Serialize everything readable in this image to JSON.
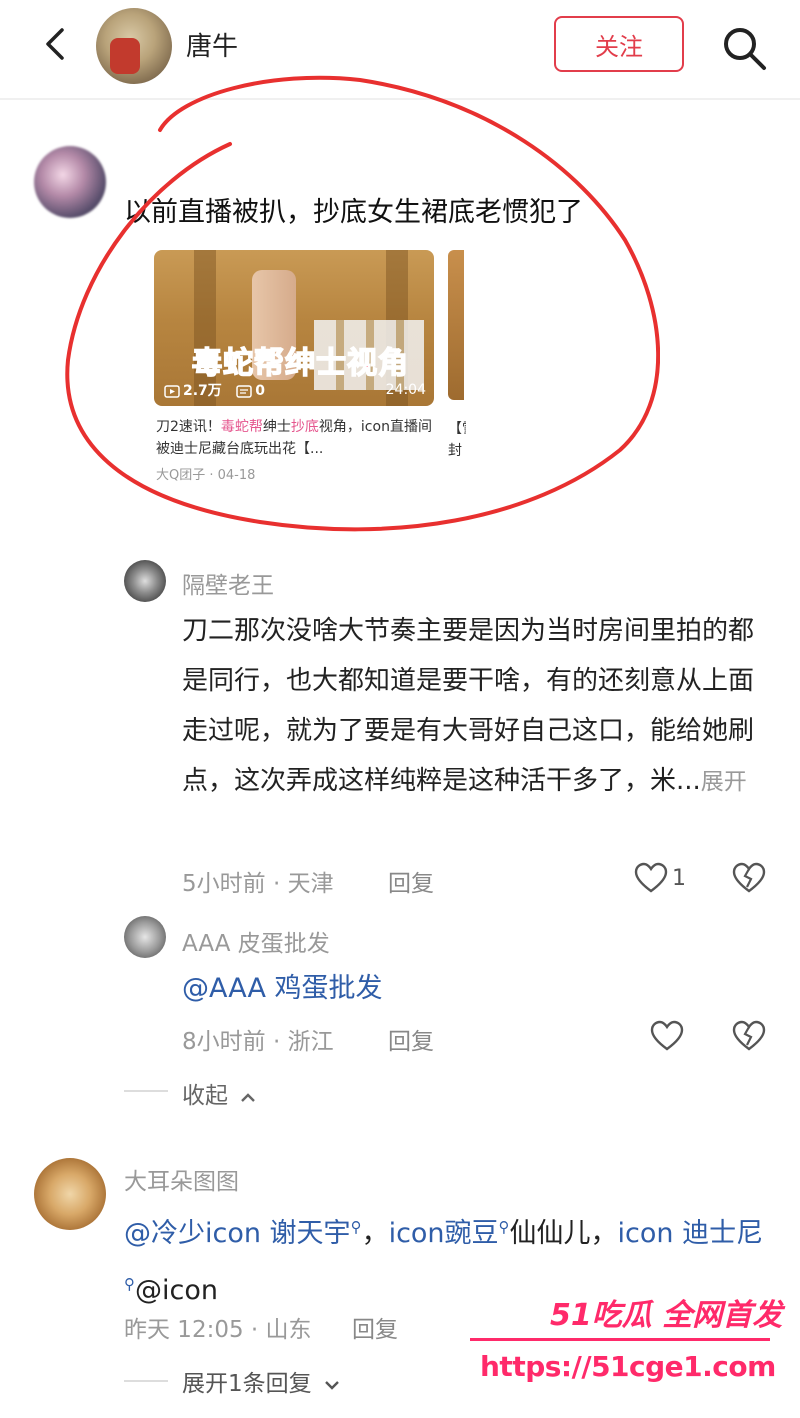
{
  "header": {
    "username": "唐牛",
    "follow_label": "关注"
  },
  "comment1": {
    "text": "以前直播被扒，抄底女生裙底老惯犯了",
    "video": {
      "overlay_text": "毒蛇帮绅士视角",
      "play_count": "2.7万",
      "danmaku_count": "0",
      "duration": "24:04",
      "title_part1": "刀2速讯！",
      "title_hl1": "毒蛇帮",
      "title_part2": "绅士",
      "title_hl2": "抄底",
      "title_part3": "视角，icon直播间被迪士尼藏台底玩出花【...",
      "author": "大Q团子",
      "date": "04-18"
    },
    "peek_text": "【雪封"
  },
  "reply1": {
    "name": "隔壁老王",
    "text": "刀二那次没啥大节奏主要是因为当时房间里拍的都是同行，也大都知道是要干啥，有的还刻意从上面走过呢，就为了要是有大哥好自己这口，能给她刷点，这次弄成这样纯粹是这种活干多了，米...",
    "expand": "展开",
    "meta": "5小时前 · 天津",
    "reply_label": "回复",
    "likes": "1"
  },
  "reply2": {
    "name": "AAA 皮蛋批发",
    "text": "@AAA 鸡蛋批发",
    "meta": "8小时前 · 浙江",
    "reply_label": "回复"
  },
  "collapse_label": "收起",
  "comment3": {
    "name": "大耳朵图图",
    "seg1": "@冷少icon 谢天宇",
    "seg2": "，",
    "seg3": "icon豌豆",
    "seg4": "仙仙儿，",
    "seg5": "icon 迪士尼",
    "seg6": "@icon",
    "meta": "昨天 12:05 · 山东",
    "reply_label": "回复",
    "expand_label": "展开1条回复"
  },
  "watermark": {
    "brand": "51吃瓜 全网首发",
    "url": "https://51cge1.com"
  },
  "colors": {
    "accent_red": "#e23d4b",
    "mention_blue": "#2f5da8",
    "highlight_pink": "#e5568e",
    "watermark_pink": "#ff2a6a"
  }
}
